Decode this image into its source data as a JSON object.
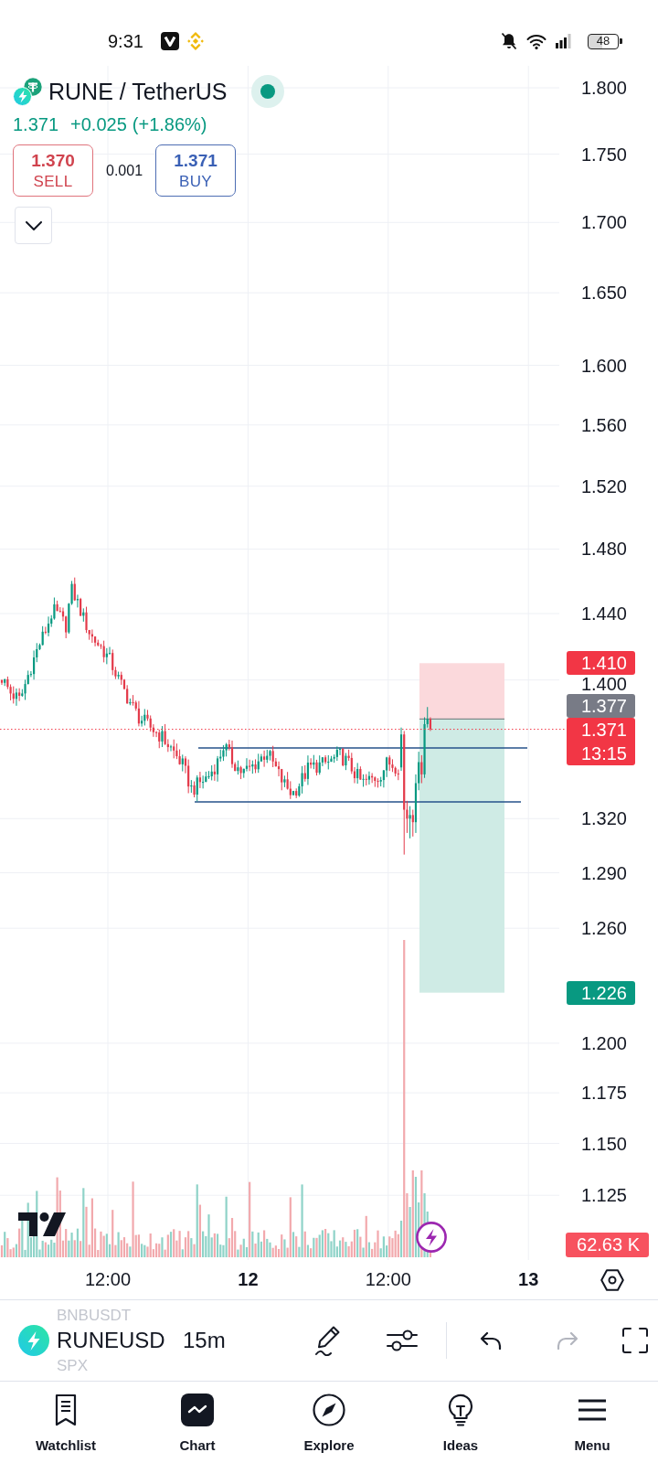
{
  "status_bar": {
    "time": "9:31",
    "battery": "48"
  },
  "symbol": {
    "title": "RUNE / TetherUS",
    "market_open": true
  },
  "quote": {
    "positive": true,
    "last": "1.371",
    "change": "+0.025",
    "change_percent": "(+1.86%)"
  },
  "trade": {
    "sell": {
      "price": "1.370",
      "label": "SELL"
    },
    "spread": "0.001",
    "buy": {
      "price": "1.371",
      "label": "BUY"
    }
  },
  "price_axis": {
    "ticks": [
      "1.800",
      "1.750",
      "1.700",
      "1.650",
      "1.600",
      "1.560",
      "1.520",
      "1.480",
      "1.440",
      "1.400",
      "1.320",
      "1.290",
      "1.260",
      "1.200",
      "1.175",
      "1.150",
      "1.125"
    ]
  },
  "price_markers": [
    {
      "kind": "stop",
      "value": "1.410",
      "color": "#f23645"
    },
    {
      "kind": "entry",
      "value": "1.377",
      "color": "#787b86"
    },
    {
      "kind": "last",
      "value": "1.371",
      "countdown": "13:15",
      "color": "#f23645"
    },
    {
      "kind": "target",
      "value": "1.226",
      "color": "#089981"
    },
    {
      "kind": "volume",
      "value": "62.63 K",
      "color": "#f7525f"
    }
  ],
  "time_axis": {
    "labels": [
      {
        "text": "12:00",
        "kind": "time"
      },
      {
        "text": "12",
        "kind": "day"
      },
      {
        "text": "12:00",
        "kind": "time"
      },
      {
        "text": "13",
        "kind": "day"
      }
    ]
  },
  "toolbar": {
    "symbols": [
      {
        "name": "BNBUSDT",
        "selected": false
      },
      {
        "name": "RUNEUSD",
        "selected": true
      },
      {
        "name": "SPX",
        "selected": false
      }
    ],
    "interval": "15m",
    "actions": [
      {
        "kind": "draw",
        "disabled": false
      },
      {
        "kind": "indicators",
        "disabled": false
      },
      {
        "kind": "undo",
        "disabled": false
      },
      {
        "kind": "redo",
        "disabled": true
      },
      {
        "kind": "fullscreen",
        "disabled": false
      }
    ]
  },
  "bottom_nav": [
    {
      "kind": "watchlist",
      "label": "Watchlist",
      "selected": false
    },
    {
      "kind": "chart",
      "label": "Chart",
      "selected": true
    },
    {
      "kind": "explore",
      "label": "Explore",
      "selected": false
    },
    {
      "kind": "ideas",
      "label": "Ideas",
      "selected": false
    },
    {
      "kind": "menu",
      "label": "Menu",
      "selected": false
    }
  ]
}
